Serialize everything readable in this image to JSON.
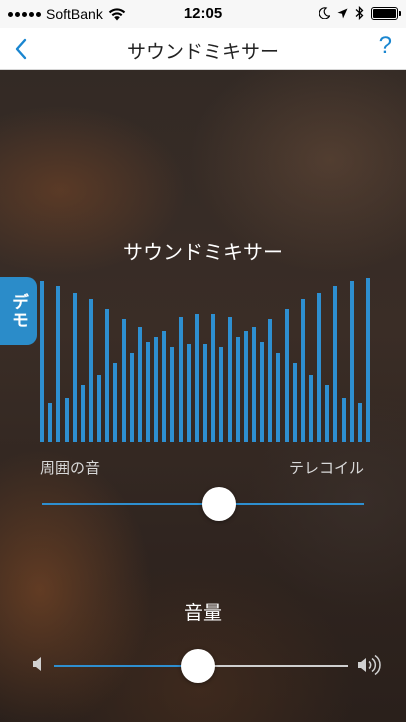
{
  "status_bar": {
    "carrier": "SoftBank",
    "time": "12:05",
    "icons": [
      "signal-icon",
      "wifi-icon",
      "moon-icon",
      "location-icon",
      "bluetooth-icon",
      "battery-icon"
    ]
  },
  "nav": {
    "title": "サウンドミキサー",
    "back_icon": "chevron-left-icon",
    "help_label": "?"
  },
  "demo_tab": {
    "label": "デモ"
  },
  "mixer": {
    "title": "サウンドミキサー",
    "left_label": "周囲の音",
    "right_label": "テレコイル",
    "balance": 0.55,
    "bar_color": "#2e8fd0",
    "bar_levels": [
      0.98,
      0.24,
      0.95,
      0.27,
      0.91,
      0.35,
      0.87,
      0.41,
      0.81,
      0.48,
      0.75,
      0.54,
      0.7,
      0.61,
      0.64,
      0.68,
      0.58,
      0.76,
      0.6,
      0.78,
      0.6,
      0.78,
      0.58,
      0.76,
      0.64,
      0.68,
      0.7,
      0.61,
      0.75,
      0.54,
      0.81,
      0.48,
      0.87,
      0.41,
      0.91,
      0.35,
      0.95,
      0.27,
      0.98,
      0.24,
      1.0
    ]
  },
  "volume": {
    "title": "音量",
    "level": 0.49,
    "min_icon": "speaker-low-icon",
    "max_icon": "speaker-high-icon"
  },
  "colors": {
    "accent": "#2e8fd0",
    "nav_tint": "#1a86d0",
    "demo_tab": "#2b8cc9"
  }
}
